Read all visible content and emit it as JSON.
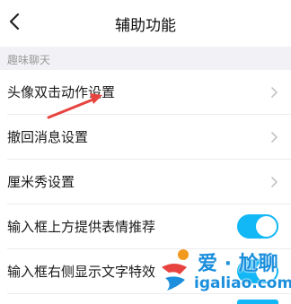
{
  "header": {
    "title": "辅助功能",
    "back_icon": "chevron-left-icon"
  },
  "section": {
    "label": "趣味聊天"
  },
  "rows": [
    {
      "label": "头像双击动作设置",
      "type": "link"
    },
    {
      "label": "撤回消息设置",
      "type": "link"
    },
    {
      "label": "厘米秀设置",
      "type": "link"
    },
    {
      "label": "输入框上方提供表情推荐",
      "type": "toggle",
      "on": true
    },
    {
      "label": "输入框右侧显示文字特效",
      "type": "toggle",
      "on": true
    }
  ],
  "colors": {
    "toggle_on": "#12b7f5",
    "arrow": "#e8433f",
    "watermark": "#1b8fdc"
  },
  "watermark": {
    "cn": "爱 · 尬聊",
    "en": "igaliao.com"
  }
}
